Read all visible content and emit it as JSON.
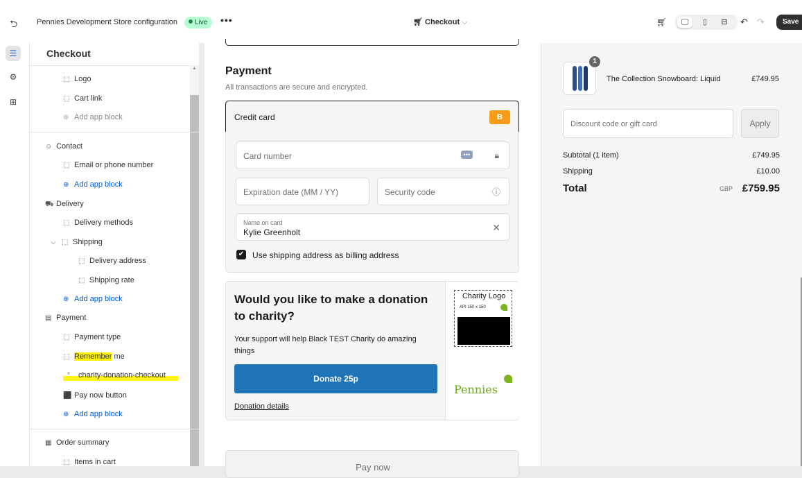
{
  "topbar": {
    "store_name": "Pennies Development Store configuration",
    "live_label": "Live",
    "more_label": "•••",
    "page_selector": "Checkout",
    "save_label": "Save"
  },
  "sidebar": {
    "title": "Checkout",
    "items": [
      {
        "label": "Logo"
      },
      {
        "label": "Cart link"
      },
      {
        "label": "Add app block"
      },
      {
        "label": "Contact"
      },
      {
        "label": "Email or phone number"
      },
      {
        "label": "Add app block"
      },
      {
        "label": "Delivery"
      },
      {
        "label": "Delivery methods"
      },
      {
        "label": "Shipping"
      },
      {
        "label": "Delivery address"
      },
      {
        "label": "Shipping rate"
      },
      {
        "label": "Add app block"
      },
      {
        "label": "Payment"
      },
      {
        "label": "Payment type"
      },
      {
        "label_part1": "Remember",
        "label_part2": " me"
      },
      {
        "label": "charity-donation-checkout"
      },
      {
        "label": "Pay now button"
      },
      {
        "label": "Add app block"
      },
      {
        "label": "Order summary"
      },
      {
        "label": "Items in cart"
      }
    ]
  },
  "payment": {
    "title": "Payment",
    "subtitle": "All transactions are secure and encrypted.",
    "method_label": "Credit card",
    "method_badge": "B",
    "card_number_placeholder": "Card number",
    "expiry_placeholder": "Expiration date (MM / YY)",
    "security_placeholder": "Security code",
    "name_label": "Name on card",
    "name_value": "Kylie Greenholt",
    "billing_checkbox_label": "Use shipping address as billing address",
    "billing_checked": true
  },
  "donation": {
    "title": "Would you like to make a donation to charity?",
    "text": "Your support will help Black TEST Charity do amazing things",
    "button_label": "Donate 25p",
    "details_link": "Donation details",
    "logo_title": "Charity Logo",
    "logo_api": "API  150 x 150",
    "brand": "Pennies"
  },
  "pay_now_label": "Pay now",
  "summary": {
    "product_qty": "1",
    "product_name": "The Collection Snowboard: Liquid",
    "product_price": "£749.95",
    "discount_placeholder": "Discount code or gift card",
    "apply_label": "Apply",
    "subtotal_label": "Subtotal (1 item)",
    "subtotal_value": "£749.95",
    "shipping_label": "Shipping",
    "shipping_value": "£10.00",
    "total_label": "Total",
    "total_currency": "GBP",
    "total_value": "£759.95"
  },
  "colors": {
    "accent_link": "#005bd3",
    "live_badge": "#b4fed2",
    "donate_button": "#1f73b7",
    "card_badge": "#f79c18",
    "highlight": "#fff200",
    "pennies_green": "#6aa917"
  },
  "icons": [
    "exit-icon",
    "cart-icon",
    "desktop-view-icon",
    "mobile-view-icon",
    "fullwidth-view-icon",
    "undo-icon",
    "redo-icon",
    "sections-icon",
    "settings-icon",
    "apps-icon",
    "block-icon",
    "add-circle-icon",
    "person-icon",
    "truck-icon",
    "payment-icon",
    "receipt-icon",
    "lock-icon",
    "help-icon",
    "close-icon",
    "check-icon"
  ]
}
